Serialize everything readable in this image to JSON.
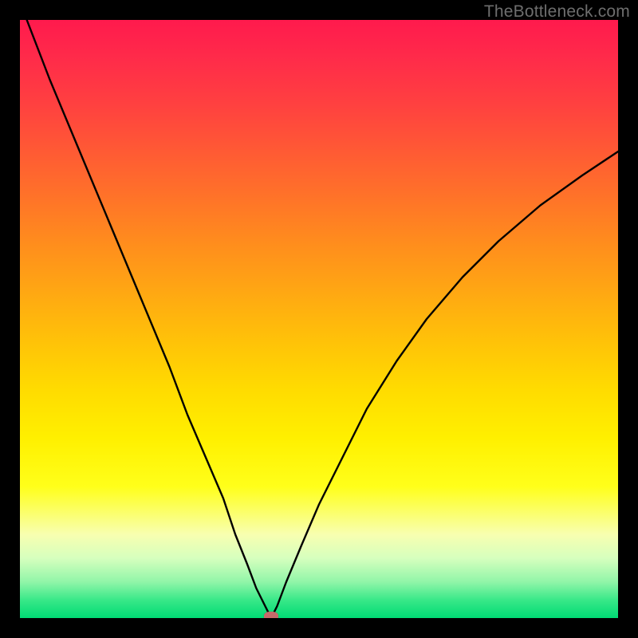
{
  "watermark": "TheBottleneck.com",
  "chart_data": {
    "type": "line",
    "title": "",
    "xlabel": "",
    "ylabel": "",
    "xlim": [
      0,
      100
    ],
    "ylim": [
      0,
      100
    ],
    "grid": false,
    "background_gradient": {
      "top": "#ff1a4d",
      "mid": "#ffdc00",
      "bottom": "#00db74"
    },
    "marker": {
      "x": 42,
      "y": 0,
      "color": "#c66a6a"
    },
    "series": [
      {
        "name": "bottleneck-curve",
        "x": [
          0,
          5,
          10,
          15,
          20,
          25,
          28,
          31,
          34,
          36,
          38,
          39.5,
          41,
          42,
          43,
          44.5,
          47,
          50,
          54,
          58,
          63,
          68,
          74,
          80,
          87,
          94,
          100
        ],
        "y": [
          103,
          90,
          78,
          66,
          54,
          42,
          34,
          27,
          20,
          14,
          9,
          5,
          2,
          0,
          2,
          6,
          12,
          19,
          27,
          35,
          43,
          50,
          57,
          63,
          69,
          74,
          78
        ]
      }
    ]
  }
}
